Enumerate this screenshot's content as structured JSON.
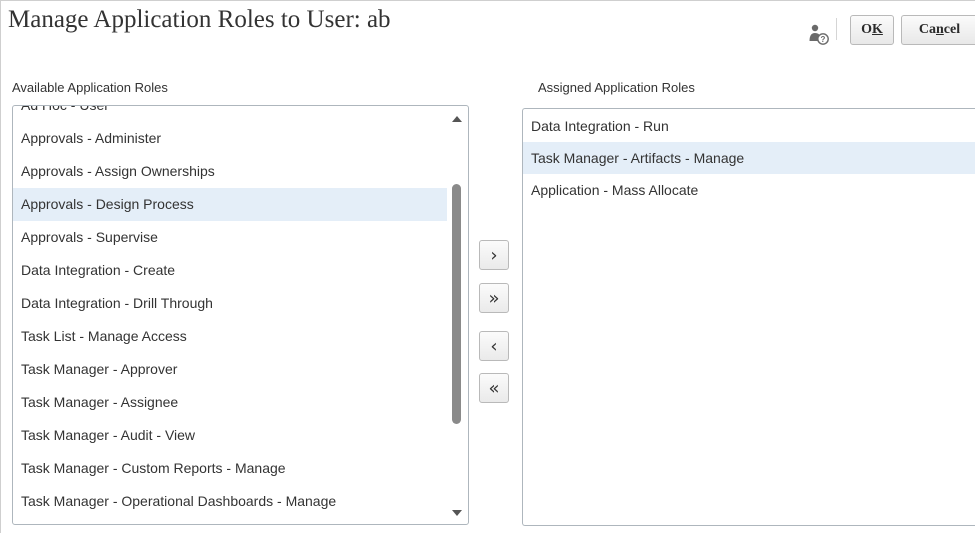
{
  "dialog": {
    "title": "Manage Application Roles to User: ab"
  },
  "toolbar": {
    "help_icon": "user-help-icon",
    "ok_label_pre": "O",
    "ok_label_underlined": "K",
    "cancel_label_pre": "Ca",
    "cancel_label_underlined": "n",
    "cancel_label_post": "cel"
  },
  "available": {
    "label": "Available Application Roles",
    "items": [
      "Ad Hoc - User",
      "Approvals - Administer",
      "Approvals - Assign Ownerships",
      "Approvals - Design Process",
      "Approvals - Supervise",
      "Data Integration - Create",
      "Data Integration - Drill Through",
      "Task List - Manage Access",
      "Task Manager - Approver",
      "Task Manager - Assignee",
      "Task Manager - Audit - View",
      "Task Manager - Custom Reports - Manage",
      "Task Manager - Operational Dashboards - Manage"
    ],
    "selected": "Approvals - Design Process"
  },
  "assigned": {
    "label": "Assigned Application Roles",
    "items": [
      "Data Integration - Run",
      "Task Manager - Artifacts - Manage",
      "Application - Mass Allocate"
    ],
    "selected": "Task Manager - Artifacts - Manage"
  },
  "shuttle": {
    "move": "›",
    "move_all": "»",
    "remove": "‹",
    "remove_all": "«"
  },
  "colors": {
    "selection": "#e4eef8",
    "border": "#aeb6bd",
    "scroll_thumb": "#8a8a8a"
  }
}
